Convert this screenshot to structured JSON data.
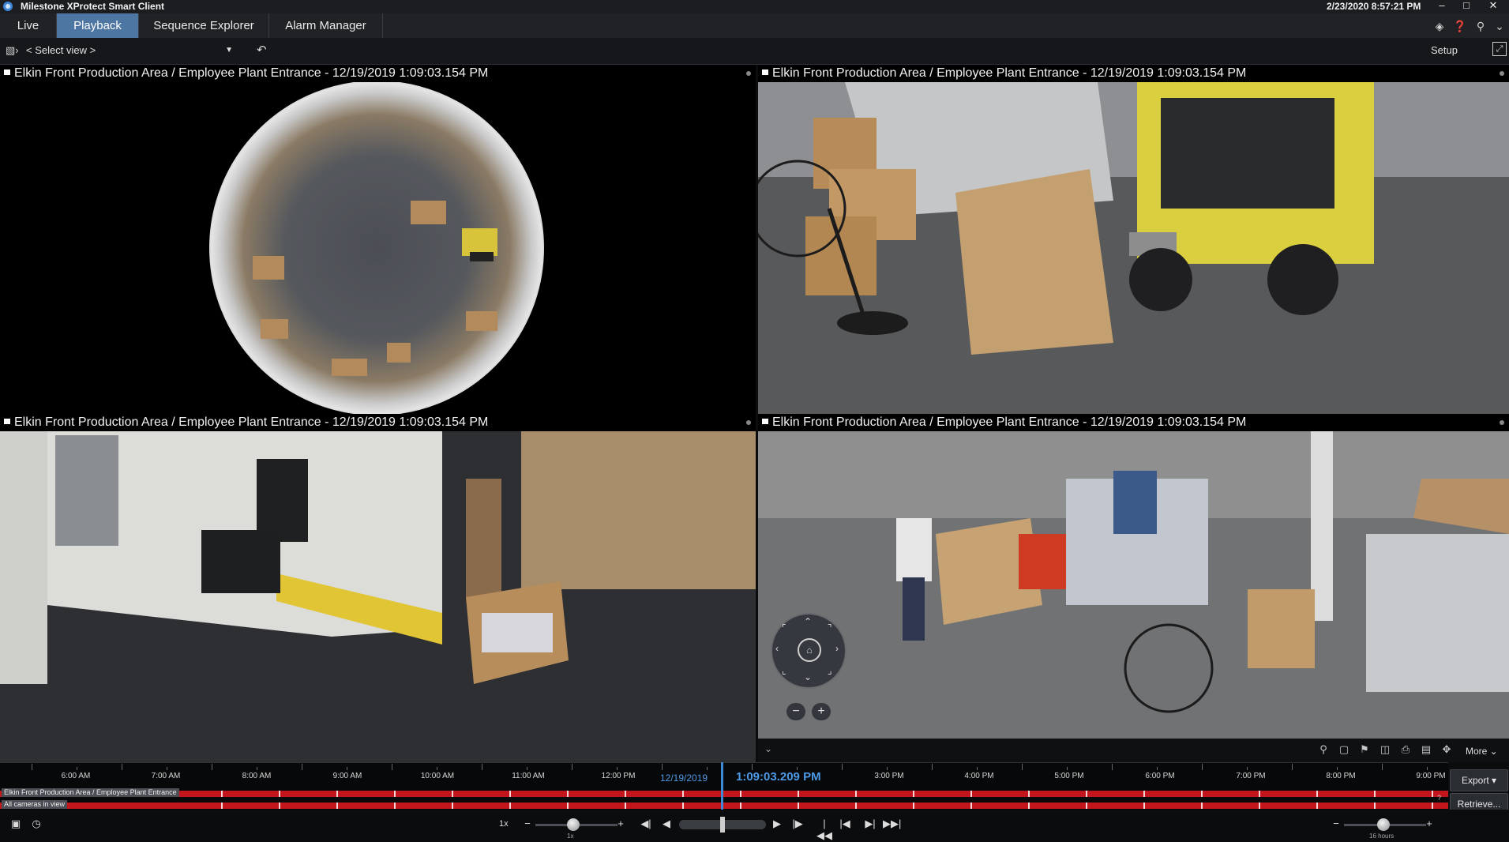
{
  "titlebar": {
    "app_title": "Milestone XProtect Smart Client",
    "datetime": "2/23/2020 8:57:21 PM"
  },
  "tabs": [
    {
      "label": "Live"
    },
    {
      "label": "Playback"
    },
    {
      "label": "Sequence Explorer"
    },
    {
      "label": "Alarm Manager"
    }
  ],
  "toolbar": {
    "select_view": "< Select view >",
    "setup": "Setup"
  },
  "cameras": [
    {
      "title": "Elkin Front Production Area / Employee Plant Entrance - 12/19/2019 1:09:03.154 PM"
    },
    {
      "title": "Elkin Front Production Area / Employee Plant Entrance - 12/19/2019 1:09:03.154 PM"
    },
    {
      "title": "Elkin Front Production Area / Employee Plant Entrance - 12/19/2019 1:09:03.154 PM"
    },
    {
      "title": "Elkin Front Production Area / Employee Plant Entrance - 12/19/2019 1:09:03.154 PM"
    }
  ],
  "tile_tools": {
    "more": "More"
  },
  "timeline": {
    "hours": [
      "6:00 AM",
      "7:00 AM",
      "8:00 AM",
      "9:00 AM",
      "10:00 AM",
      "11:00 AM",
      "12:00 PM",
      "3:00 PM",
      "4:00 PM",
      "5:00 PM",
      "6:00 PM",
      "7:00 PM",
      "8:00 PM",
      "9:00 PM"
    ],
    "date": "12/19/2019",
    "current_time": "1:09:03.209 PM",
    "track1_label": "Elkin Front Production Area / Employee Plant Entrance",
    "track2_label": "All cameras in view",
    "question_mark": "?"
  },
  "buttons": {
    "export": "Export",
    "retrieve": "Retrieve..."
  },
  "playback": {
    "speed": "1x",
    "speed_sub": "1x",
    "range_sub": "16 hours"
  },
  "colors": {
    "accent": "#4d76a3",
    "selection": "#4a8fd6",
    "recording_track": "#c3161c",
    "time_cursor": "#3e8ad9"
  }
}
